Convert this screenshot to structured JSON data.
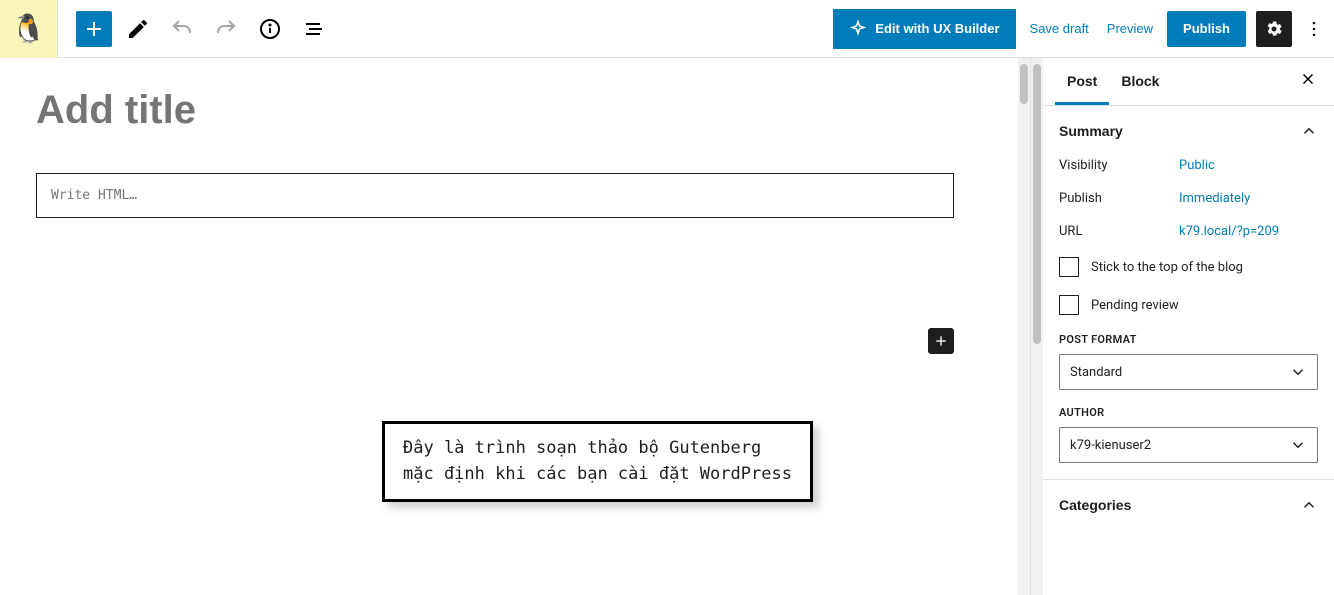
{
  "toolbar": {
    "ux_builder_label": "Edit with UX Builder",
    "save_draft_label": "Save draft",
    "preview_label": "Preview",
    "publish_label": "Publish"
  },
  "editor": {
    "title_placeholder": "Add title",
    "html_block_placeholder": "Write HTML…"
  },
  "annotation": {
    "line1": "Đây là trình soạn thảo bộ Gutenberg",
    "line2": "mặc định khi các bạn cài đặt WordPress"
  },
  "sidebar": {
    "tabs": {
      "post": "Post",
      "block": "Block"
    },
    "summary": {
      "heading": "Summary",
      "visibility_label": "Visibility",
      "visibility_value": "Public",
      "publish_label": "Publish",
      "publish_value": "Immediately",
      "url_label": "URL",
      "url_value": "k79.local/?p=209",
      "stick_label": "Stick to the top of the blog",
      "pending_label": "Pending review"
    },
    "post_format": {
      "heading": "POST FORMAT",
      "value": "Standard"
    },
    "author": {
      "heading": "AUTHOR",
      "value": "k79-kienuser2"
    },
    "categories": {
      "heading": "Categories"
    }
  }
}
